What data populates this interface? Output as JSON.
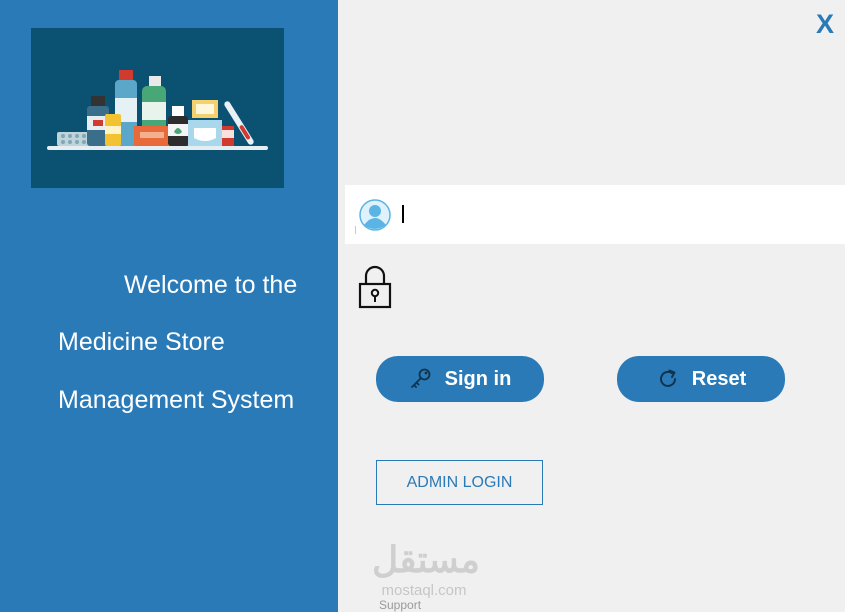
{
  "welcome": {
    "line1": "Welcome to the",
    "line2": "Medicine Store",
    "line3": "Management System"
  },
  "close": {
    "label": "X"
  },
  "username": {
    "value": "",
    "placeholder": ""
  },
  "buttons": {
    "sign_in": "Sign in",
    "reset": "Reset",
    "admin_login": "ADMIN LOGIN"
  },
  "watermark": {
    "arabic": "مستقل",
    "latin": "mostaql.com",
    "support": "Support"
  },
  "colors": {
    "panel_blue": "#2a7ab8",
    "hero_bg": "#0b5272",
    "background": "#f0f0f0"
  },
  "icons": {
    "close": "close-icon",
    "user": "user-icon",
    "lock": "lock-icon",
    "key": "key-icon",
    "refresh": "refresh-icon"
  }
}
